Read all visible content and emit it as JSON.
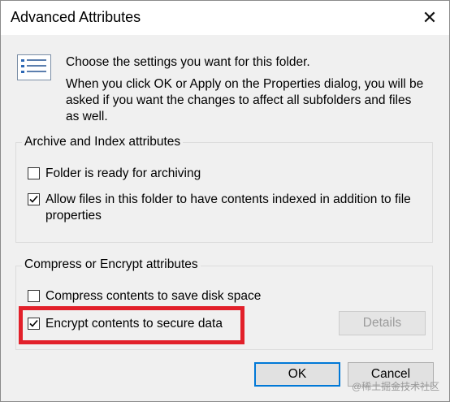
{
  "window": {
    "title": "Advanced Attributes",
    "close_glyph": "✕"
  },
  "intro": {
    "icon": "attributes-list-icon",
    "line1": "Choose the settings you want for this folder.",
    "line2": "When you click OK or Apply on the Properties dialog, you will be",
    "line3": "asked if you want the changes to affect all subfolders and files",
    "line4": "as well."
  },
  "archive_group": {
    "legend": "Archive and Index attributes",
    "archiving": {
      "label": "Folder is ready for archiving",
      "checked": false
    },
    "indexing": {
      "label_line1": "Allow files in this folder to have contents indexed in addition to file",
      "label_line2": "properties",
      "checked": true
    }
  },
  "compress_group": {
    "legend": "Compress or Encrypt attributes",
    "compress": {
      "label": "Compress contents to save disk space",
      "checked": false
    },
    "encrypt": {
      "label": "Encrypt contents to secure data",
      "checked": true
    },
    "details_label": "Details"
  },
  "buttons": {
    "ok": "OK",
    "cancel": "Cancel"
  },
  "watermark": "@稀土掘金技术社区",
  "colors": {
    "highlight": "#e2202a",
    "focus_border": "#0078d7"
  }
}
